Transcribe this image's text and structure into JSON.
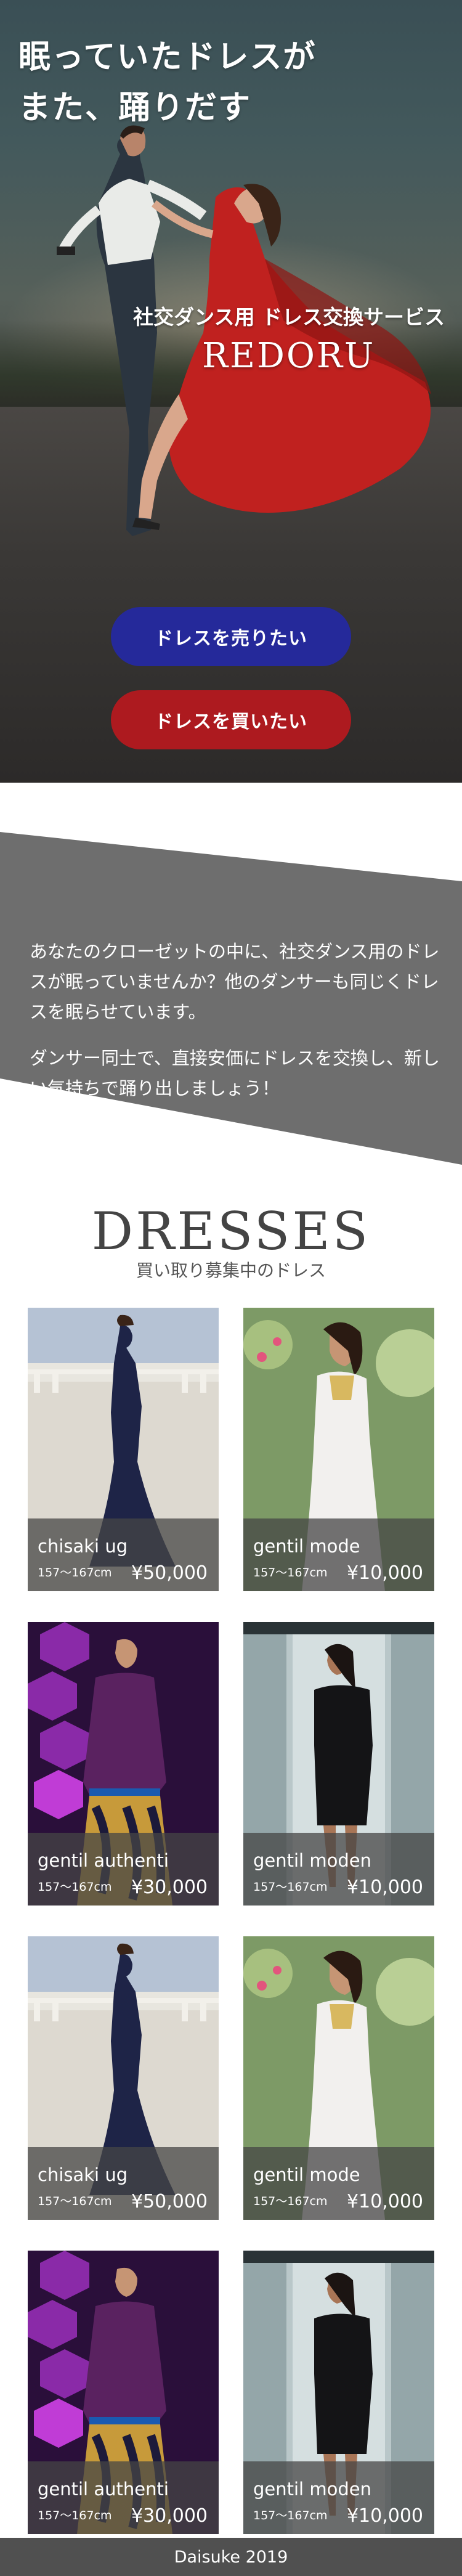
{
  "hero": {
    "title_line1": "眠っていたドレスが",
    "title_line2": "また、踊りだす",
    "subtitle": "社交ダンス用 ドレス交換サービス",
    "brand": "REDORU",
    "sell_button": "ドレスを売りたい",
    "buy_button": "ドレスを買いたい",
    "colors": {
      "sell": "#25299a",
      "buy": "#ad1a1f"
    }
  },
  "intro": {
    "paragraph1": "あなたのクローゼットの中に、社交ダンス用のドレスが眠っていませんか？他のダンサーも同じくドレスを眠らせています。",
    "paragraph2": "ダンサー同士で、直接安価にドレスを交換し、新しい気持ちで踊り出しましょう！",
    "background_color": "#6e6e6e"
  },
  "dresses": {
    "title": "DRESSES",
    "subtitle": "買い取り募集中のドレス",
    "items": [
      {
        "name": "chisaki ug",
        "size": "157〜167cm",
        "price": "¥50,000",
        "image": "navy-gown-photo"
      },
      {
        "name": "gentil mode",
        "size": "157〜167cm",
        "price": "¥10,000",
        "image": "white-dress-photo"
      },
      {
        "name": "gentil authenti",
        "size": "157〜167cm",
        "price": "¥30,000",
        "image": "purple-lace-dress-photo"
      },
      {
        "name": "gentil moden",
        "size": "157〜167cm",
        "price": "¥10,000",
        "image": "black-short-dress-photo"
      },
      {
        "name": "chisaki ug",
        "size": "157〜167cm",
        "price": "¥50,000",
        "image": "navy-gown-photo"
      },
      {
        "name": "gentil mode",
        "size": "157〜167cm",
        "price": "¥10,000",
        "image": "white-dress-photo"
      },
      {
        "name": "gentil authenti",
        "size": "157〜167cm",
        "price": "¥30,000",
        "image": "purple-lace-dress-photo"
      },
      {
        "name": "gentil moden",
        "size": "157〜167cm",
        "price": "¥10,000",
        "image": "black-short-dress-photo"
      }
    ]
  },
  "footer": {
    "text": "Daisuke 2019"
  }
}
